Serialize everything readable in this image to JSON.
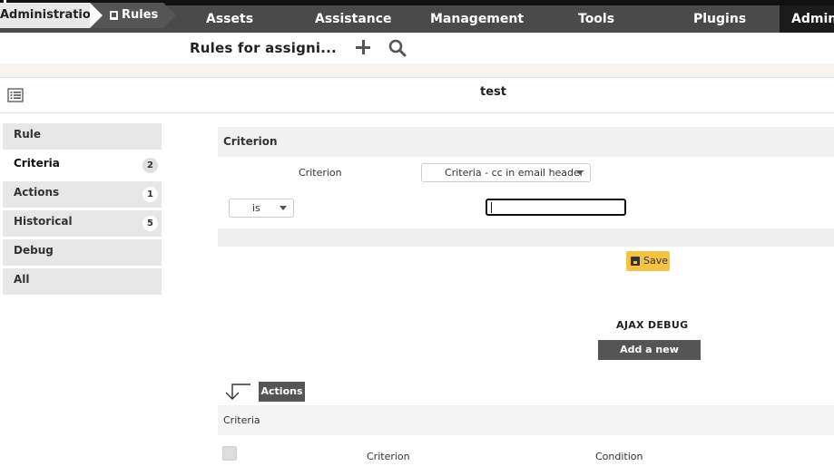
{
  "nav": {
    "items": [
      "Assets",
      "Assistance",
      "Management",
      "Tools",
      "Plugins"
    ],
    "active": "Admin"
  },
  "breadcrumb": {
    "root": "Administration",
    "current": "Rules"
  },
  "page_title": "Rules for assigni...",
  "object": {
    "name": "test"
  },
  "tabs": [
    {
      "label": "Rule",
      "badge": ""
    },
    {
      "label": "Criteria",
      "badge": "2"
    },
    {
      "label": "Actions",
      "badge": "1"
    },
    {
      "label": "Historical",
      "badge": "5"
    },
    {
      "label": "Debug",
      "badge": ""
    },
    {
      "label": "All",
      "badge": ""
    }
  ],
  "form": {
    "header": "Criterion",
    "criterion_label": "Criterion",
    "criterion_value": "Criteria - cc in email header",
    "operator_value": "is",
    "pattern_value": "",
    "save_label": "Save"
  },
  "ajax_debug": "AJAX DEBUG",
  "add_criterion_label": "Add a new criterion",
  "actions_label": "Actions",
  "list": {
    "header": "Criteria",
    "columns": [
      "Criterion",
      "Condition"
    ]
  }
}
